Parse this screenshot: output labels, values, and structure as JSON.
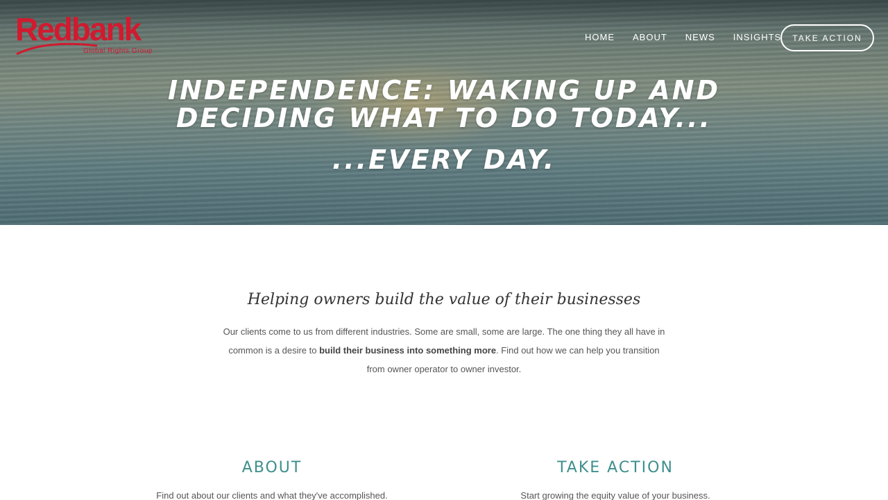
{
  "brand": {
    "logo_text": "Redbank",
    "tagline": "Global Rights Group",
    "color": "#d11a2f"
  },
  "nav": {
    "items": [
      {
        "label": "HOME"
      },
      {
        "label": "ABOUT"
      },
      {
        "label": "NEWS"
      },
      {
        "label": "INSIGHTS"
      }
    ],
    "cta_label": "TAKE ACTION"
  },
  "hero": {
    "title_line1": "INDEPENDENCE: WAKING UP AND",
    "title_line2": "DECIDING WHAT TO DO TODAY...",
    "subtitle": "...EVERY DAY."
  },
  "intro": {
    "heading": "Helping owners build the value of their businesses",
    "body_part1": "Our clients come to us from different industries.  Some are small, some are large.  The one thing they all have in common is a desire to ",
    "body_bold": "build their business into something more",
    "body_part2": ".  Find out how we can help you transition from owner operator to owner investor."
  },
  "columns": {
    "about": {
      "heading": "ABOUT",
      "text": "Find out about our clients and what they've accomplished."
    },
    "take_action": {
      "heading": "TAKE ACTION",
      "text": "Start growing the equity value of your business."
    }
  },
  "colors": {
    "accent": "#3e8f8d",
    "text": "#555555"
  }
}
